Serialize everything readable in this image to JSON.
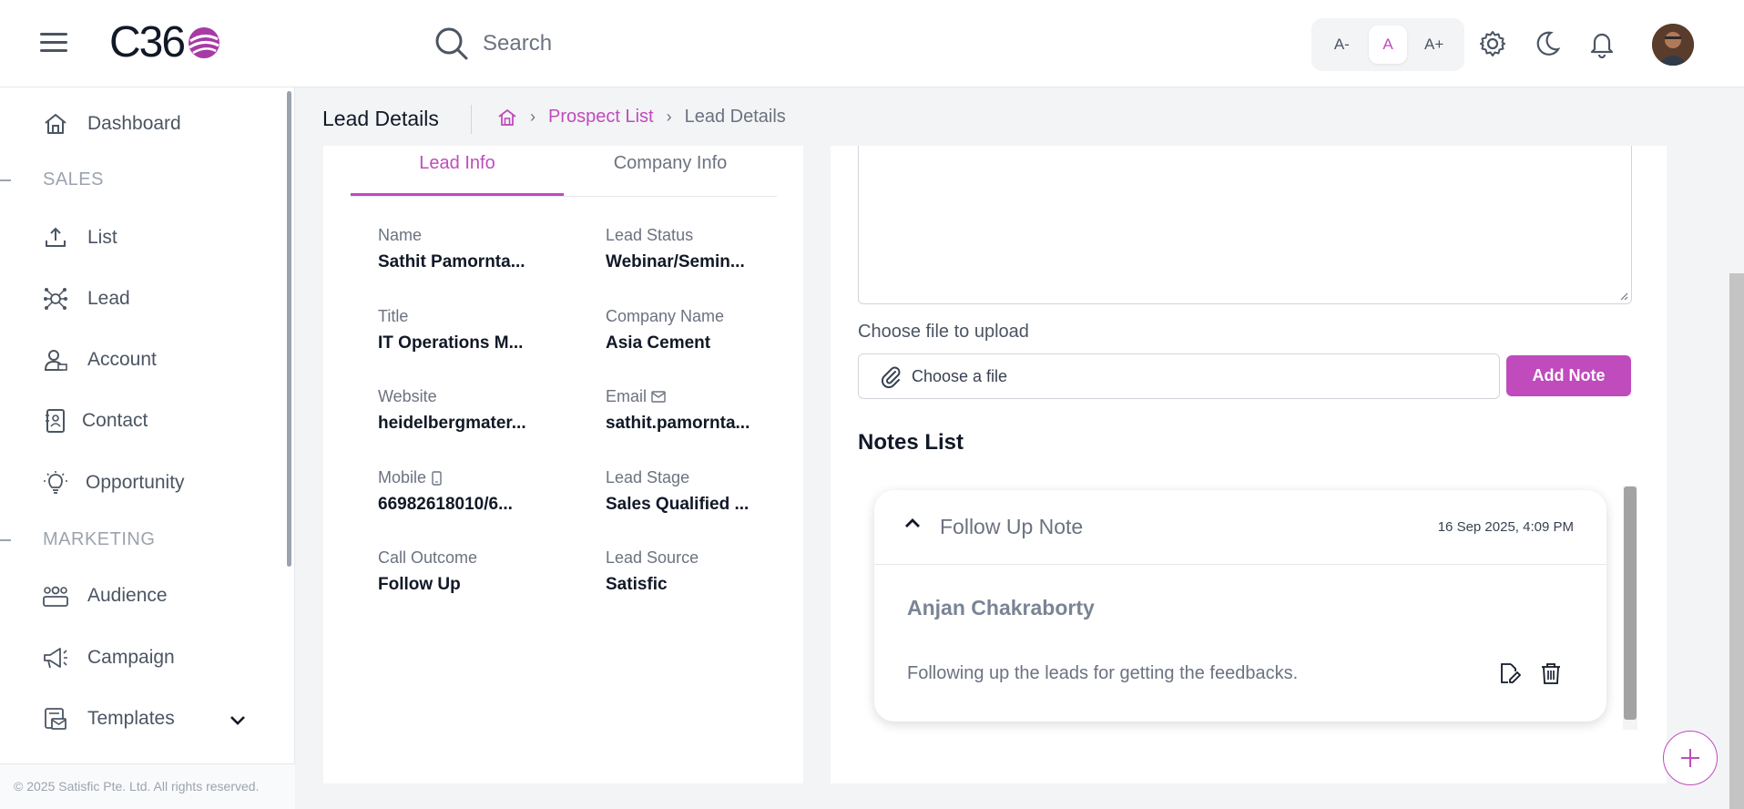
{
  "app": {
    "logo_text": "C36"
  },
  "topbar": {
    "search_placeholder": "Search",
    "font_decrease": "A-",
    "font_normal": "A",
    "font_increase": "A+"
  },
  "sidebar": {
    "items": [
      {
        "label": "Dashboard",
        "icon": "home-icon"
      },
      {
        "label": "List",
        "icon": "upload-icon"
      },
      {
        "label": "Lead",
        "icon": "lead-network-icon"
      },
      {
        "label": "Account",
        "icon": "user-icon"
      },
      {
        "label": "Contact",
        "icon": "contact-card-icon"
      },
      {
        "label": "Opportunity",
        "icon": "lightbulb-icon"
      },
      {
        "label": "Audience",
        "icon": "group-icon"
      },
      {
        "label": "Campaign",
        "icon": "megaphone-icon"
      },
      {
        "label": "Templates",
        "icon": "template-mail-icon"
      }
    ],
    "sections": [
      "SALES",
      "MARKETING"
    ],
    "footer": "© 2025 Satisfic Pte. Ltd. All rights reserved."
  },
  "header": {
    "title": "Lead Details",
    "breadcrumb": [
      "Prospect List",
      "Lead Details"
    ]
  },
  "lead": {
    "tabs": [
      "Lead Info",
      "Company Info"
    ],
    "fields": [
      {
        "label": "Name",
        "value": "Sathit Pamornta..."
      },
      {
        "label": "Lead Status",
        "value": "Webinar/Semin..."
      },
      {
        "label": "Title",
        "value": "IT Operations M..."
      },
      {
        "label": "Company Name",
        "value": "Asia Cement"
      },
      {
        "label": "Website",
        "value": "heidelbergmater..."
      },
      {
        "label": "Email",
        "value": "sathit.pamornta..."
      },
      {
        "label": "Mobile",
        "value": "66982618010/6..."
      },
      {
        "label": "Lead Stage",
        "value": "Sales Qualified ..."
      },
      {
        "label": "Call Outcome",
        "value": "Follow Up"
      },
      {
        "label": "Lead Source",
        "value": "Satisfic"
      }
    ]
  },
  "notes": {
    "upload_label": "Choose file to upload",
    "file_placeholder": "Choose a file",
    "add_button": "Add Note",
    "list_title": "Notes List",
    "items": [
      {
        "title": "Follow Up Note",
        "date": "16 Sep 2025, 4:09 PM",
        "author": "Anjan Chakraborty",
        "body": "Following up the leads for getting the feedbacks."
      }
    ]
  },
  "colors": {
    "accent": "#c04bbd"
  }
}
